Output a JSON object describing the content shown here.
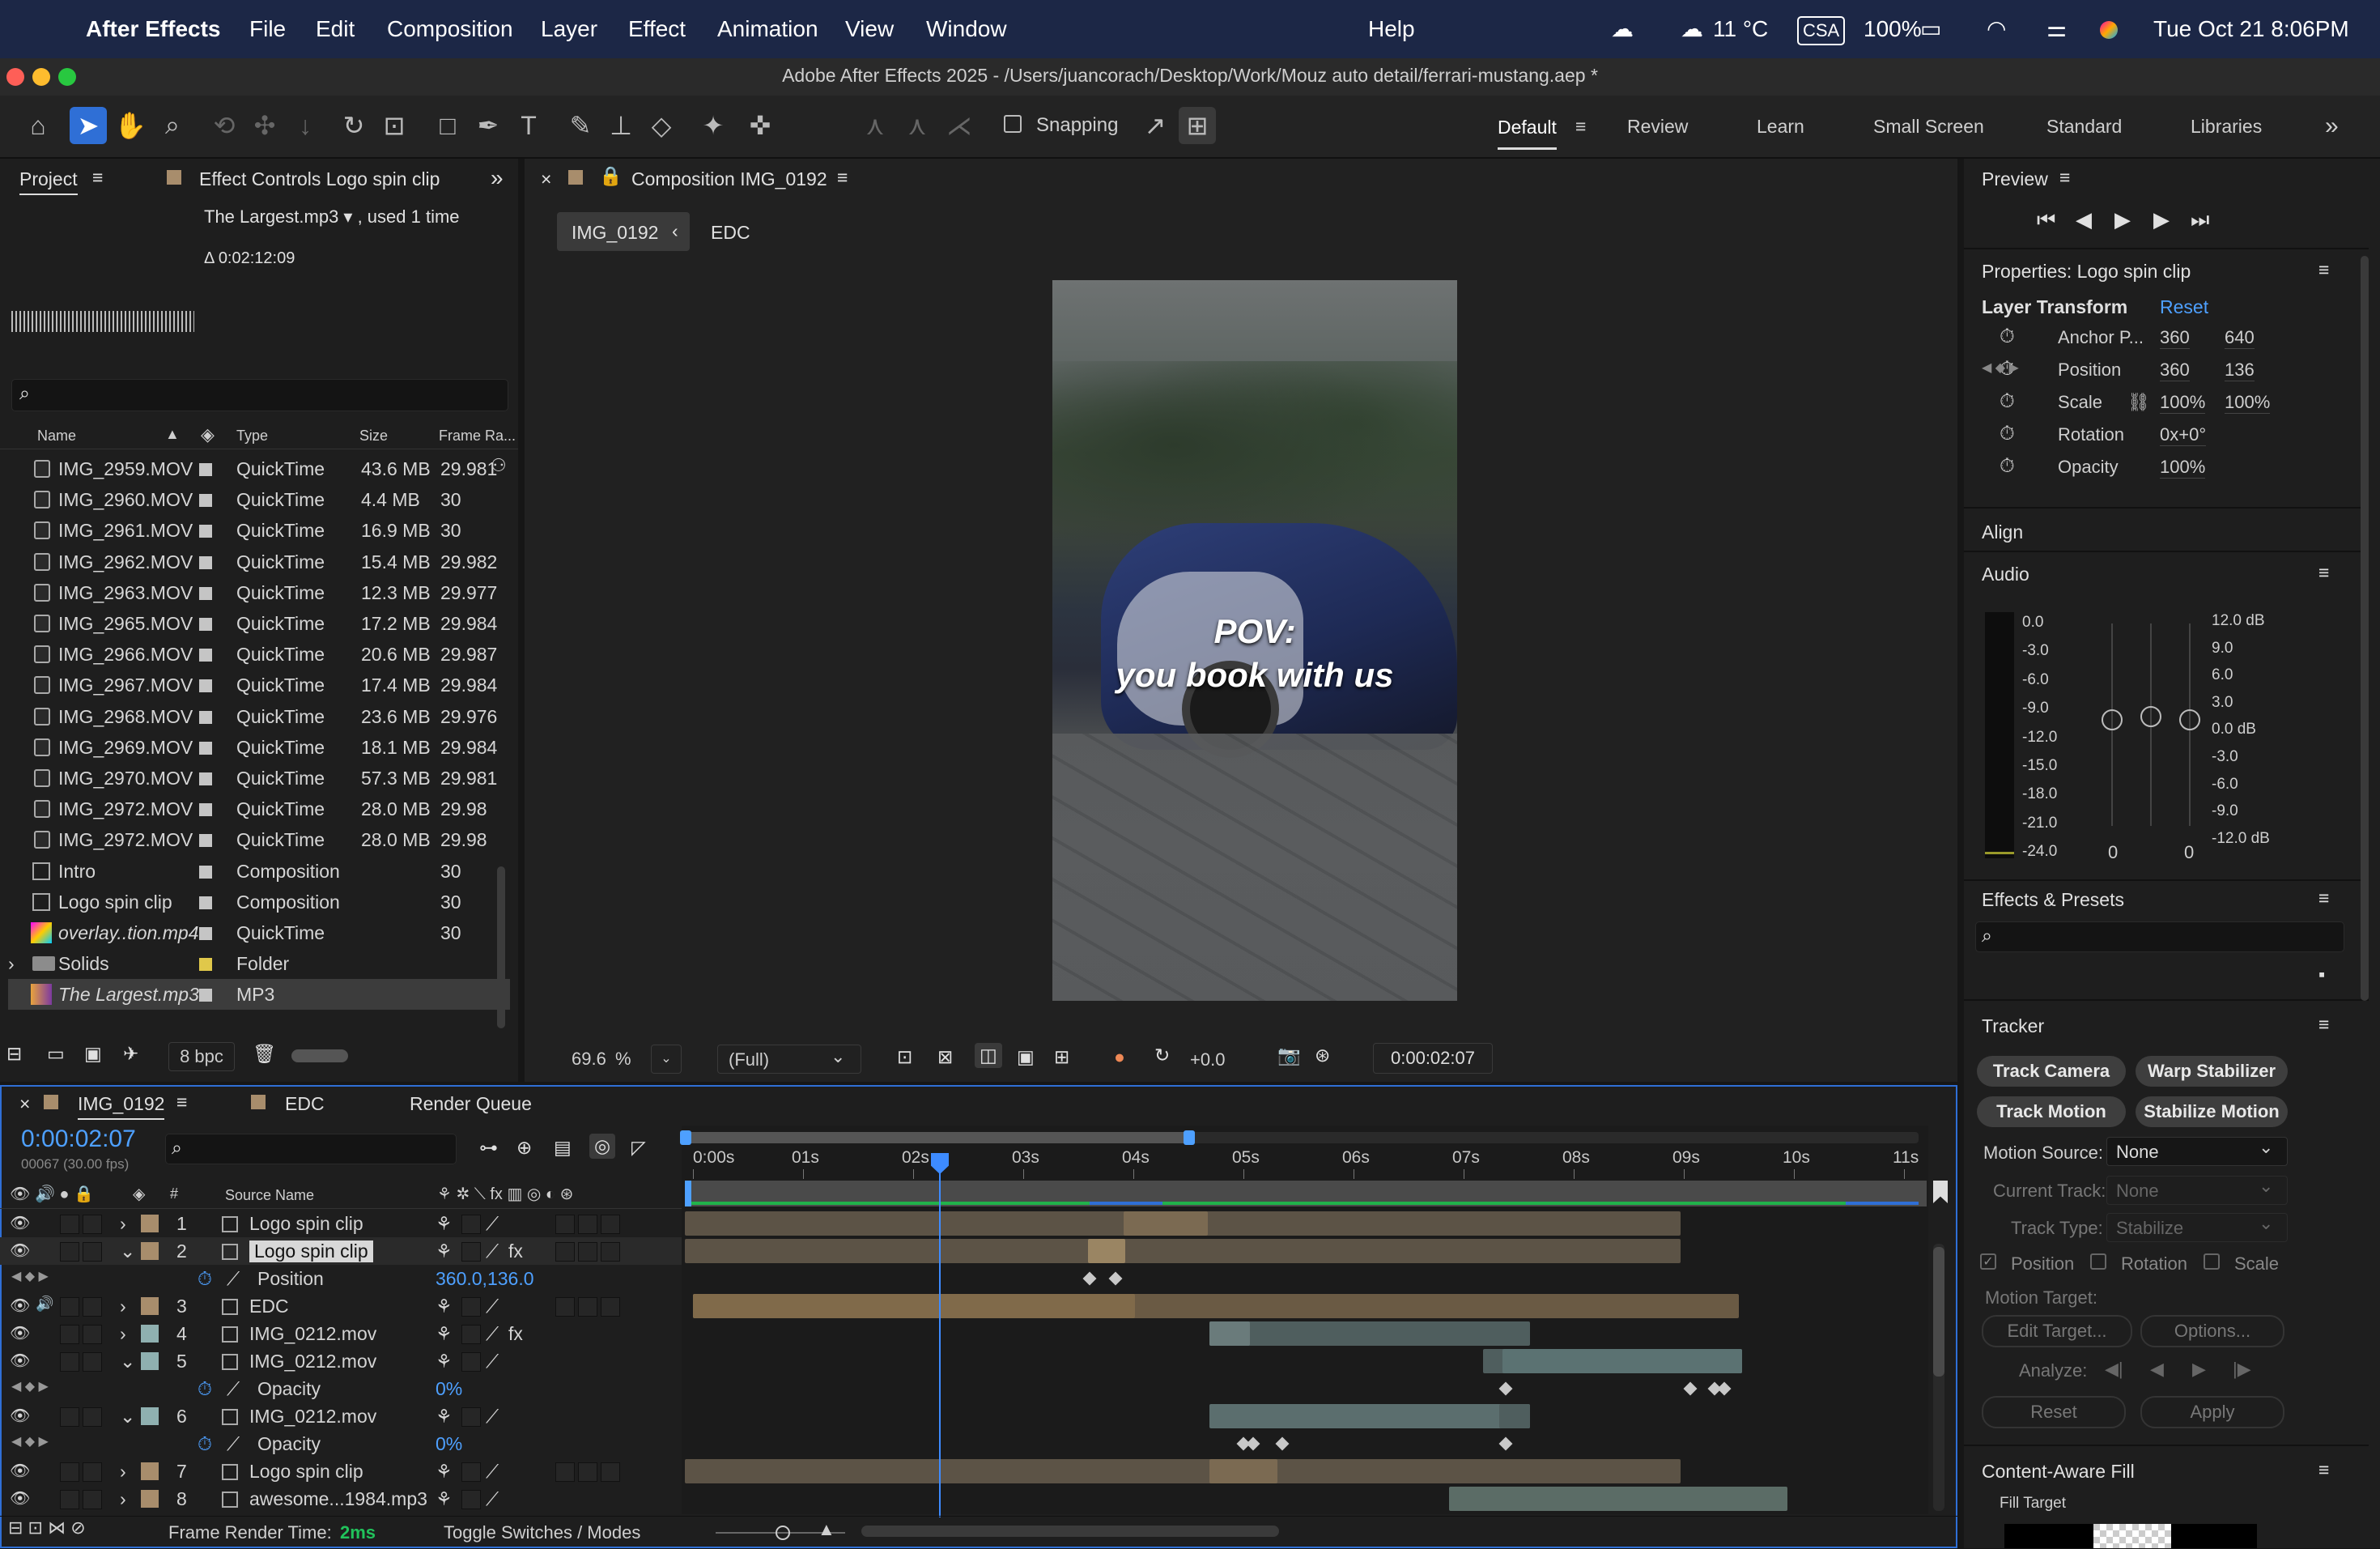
{
  "menubar": {
    "app": "After Effects",
    "items": [
      "File",
      "Edit",
      "Composition",
      "Layer",
      "Effect",
      "Animation",
      "View",
      "Window"
    ],
    "help": "Help",
    "weather": "11 °C",
    "kbd": "CSA",
    "battery": "100%",
    "clock": "Tue Oct 21  8:06PM"
  },
  "window": {
    "title": "Adobe After Effects 2025 - /Users/juancorach/Desktop/Work/Mouz auto detail/ferrari-mustang.aep *"
  },
  "toolbar": {
    "snapping": "Snapping",
    "workspaces": [
      "Default",
      "Review",
      "Learn",
      "Small Screen",
      "Standard",
      "Libraries"
    ],
    "active_workspace": "Default"
  },
  "project": {
    "tab": "Project",
    "effect_controls_tab": "Effect Controls Logo spin clip",
    "selected_info": "The Largest.mp3 ▾ , used 1 time",
    "duration": "Δ 0:02:12:09",
    "columns": [
      "Name",
      "Type",
      "Size",
      "Frame Ra..."
    ],
    "items": [
      {
        "name": "IMG_2959.MOV",
        "type": "QuickTime",
        "size": "43.6 MB",
        "fps": "29.981"
      },
      {
        "name": "IMG_2960.MOV",
        "type": "QuickTime",
        "size": "4.4 MB",
        "fps": "30"
      },
      {
        "name": "IMG_2961.MOV",
        "type": "QuickTime",
        "size": "16.9 MB",
        "fps": "30"
      },
      {
        "name": "IMG_2962.MOV",
        "type": "QuickTime",
        "size": "15.4 MB",
        "fps": "29.982"
      },
      {
        "name": "IMG_2963.MOV",
        "type": "QuickTime",
        "size": "12.3 MB",
        "fps": "29.977"
      },
      {
        "name": "IMG_2965.MOV",
        "type": "QuickTime",
        "size": "17.2 MB",
        "fps": "29.984"
      },
      {
        "name": "IMG_2966.MOV",
        "type": "QuickTime",
        "size": "20.6 MB",
        "fps": "29.987"
      },
      {
        "name": "IMG_2967.MOV",
        "type": "QuickTime",
        "size": "17.4 MB",
        "fps": "29.984"
      },
      {
        "name": "IMG_2968.MOV",
        "type": "QuickTime",
        "size": "23.6 MB",
        "fps": "29.976"
      },
      {
        "name": "IMG_2969.MOV",
        "type": "QuickTime",
        "size": "18.1 MB",
        "fps": "29.984"
      },
      {
        "name": "IMG_2970.MOV",
        "type": "QuickTime",
        "size": "57.3 MB",
        "fps": "29.981"
      },
      {
        "name": "IMG_2972.MOV",
        "type": "QuickTime",
        "size": "28.0 MB",
        "fps": "29.98"
      },
      {
        "name": "IMG_2972.MOV",
        "type": "QuickTime",
        "size": "28.0 MB",
        "fps": "29.98"
      },
      {
        "name": "Intro",
        "type": "Composition",
        "size": "",
        "fps": "30"
      },
      {
        "name": "Logo spin clip",
        "type": "Composition",
        "size": "",
        "fps": "30"
      },
      {
        "name": "overlay..tion.mp4",
        "type": "QuickTime",
        "size": "",
        "fps": "30"
      },
      {
        "name": "Solids",
        "type": "Folder",
        "size": "",
        "fps": ""
      },
      {
        "name": "The Largest.mp3",
        "type": "MP3",
        "size": "",
        "fps": ""
      }
    ],
    "bpc": "8 bpc"
  },
  "composition": {
    "tab": "Composition IMG_0192",
    "breadcrumbs": [
      "IMG_0192",
      "EDC"
    ],
    "overlay_line1": "POV:",
    "overlay_line2": "you book with us",
    "zoom": "69.6",
    "zoom_unit": "%",
    "resolution": "(Full)",
    "exposure": "+0.0",
    "timecode": "0:00:02:07"
  },
  "preview": {
    "title": "Preview"
  },
  "properties": {
    "title": "Properties: Logo spin clip",
    "section": "Layer Transform",
    "reset": "Reset",
    "rows": [
      {
        "label": "Anchor P...",
        "v1": "360",
        "v2": "640"
      },
      {
        "label": "Position",
        "v1": "360",
        "v2": "136"
      },
      {
        "label": "Scale",
        "v1": "100%",
        "v2": "100%"
      },
      {
        "label": "Rotation",
        "v1": "0x+0°",
        "v2": ""
      },
      {
        "label": "Opacity",
        "v1": "100%",
        "v2": ""
      }
    ]
  },
  "align": {
    "title": "Align"
  },
  "audio": {
    "title": "Audio",
    "left_scale": [
      "0.0",
      "-3.0",
      "-6.0",
      "-9.0",
      "-12.0",
      "-15.0",
      "-18.0",
      "-21.0",
      "-24.0"
    ],
    "right_scale": [
      "12.0 dB",
      "9.0",
      "6.0",
      "3.0",
      "0.0 dB",
      "-3.0",
      "-6.0",
      "-9.0",
      "-12.0 dB"
    ],
    "left_value": "0",
    "right_value": "0"
  },
  "effects": {
    "title": "Effects & Presets"
  },
  "tracker": {
    "title": "Tracker",
    "buttons": [
      "Track Camera",
      "Warp Stabilizer",
      "Track Motion",
      "Stabilize Motion"
    ],
    "motion_source_label": "Motion Source:",
    "motion_source": "None",
    "current_track_label": "Current Track:",
    "current_track": "None",
    "track_type_label": "Track Type:",
    "track_type": "Stabilize",
    "checks": [
      "Position",
      "Rotation",
      "Scale"
    ],
    "motion_target": "Motion Target:",
    "edit_target": "Edit Target...",
    "options": "Options...",
    "analyze": "Analyze:",
    "reset": "Reset",
    "apply": "Apply"
  },
  "caf": {
    "title": "Content-Aware Fill",
    "fill_target": "Fill Target"
  },
  "timeline": {
    "tabs": [
      "IMG_0192",
      "EDC",
      "Render Queue"
    ],
    "timecode": "0:00:02:07",
    "frames": "00067 (30.00 fps)",
    "source_name_header": "Source Name",
    "ruler": [
      "0:00s",
      "01s",
      "02s",
      "03s",
      "04s",
      "05s",
      "06s",
      "07s",
      "08s",
      "09s",
      "10s",
      "11s"
    ],
    "layers": [
      {
        "num": "1",
        "name": "Logo spin clip",
        "color": "#a88d6c",
        "fx": ""
      },
      {
        "num": "2",
        "name": "Logo spin clip",
        "color": "#a88d6c",
        "fx": "fx"
      },
      {
        "num": "",
        "name": "Position",
        "value": "360.0,136.0"
      },
      {
        "num": "3",
        "name": "EDC",
        "color": "#a88d6c",
        "fx": ""
      },
      {
        "num": "4",
        "name": "IMG_0212.mov",
        "color": "#8fb0b0",
        "fx": "fx"
      },
      {
        "num": "5",
        "name": "IMG_0212.mov",
        "color": "#8fb0b0",
        "fx": ""
      },
      {
        "num": "",
        "name": "Opacity",
        "value": "0%"
      },
      {
        "num": "6",
        "name": "IMG_0212.mov",
        "color": "#8fb0b0",
        "fx": ""
      },
      {
        "num": "",
        "name": "Opacity",
        "value": "0%"
      },
      {
        "num": "7",
        "name": "Logo spin clip",
        "color": "#a88d6c",
        "fx": ""
      },
      {
        "num": "8",
        "name": "awesome...1984.mp3",
        "color": "#a88d6c",
        "fx": ""
      }
    ],
    "frame_render_label": "Frame Render Time:",
    "frame_render_value": "2ms",
    "toggle": "Toggle Switches / Modes"
  }
}
